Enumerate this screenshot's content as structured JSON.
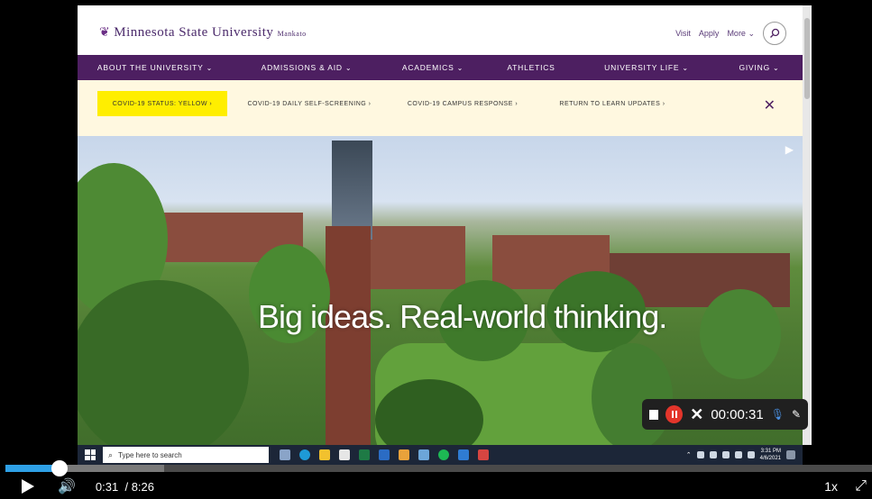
{
  "site": {
    "logo_text": "Minnesota State University",
    "logo_sub": "Mankato",
    "header_links": [
      "Visit",
      "Apply",
      "More"
    ],
    "nav": [
      {
        "label": "ABOUT THE UNIVERSITY",
        "chevron": true
      },
      {
        "label": "ADMISSIONS & AID",
        "chevron": true
      },
      {
        "label": "ACADEMICS",
        "chevron": true
      },
      {
        "label": "ATHLETICS",
        "chevron": false
      },
      {
        "label": "UNIVERSITY LIFE",
        "chevron": true
      },
      {
        "label": "GIVING",
        "chevron": true
      }
    ],
    "alerts": [
      "COVID-19 STATUS: YELLOW  ›",
      "COVID-19 DAILY SELF-SCREENING  ›",
      "COVID-19 CAMPUS RESPONSE  ›",
      "RETURN TO LEARN UPDATES  ›"
    ],
    "hero_text": "Big ideas. Real-world thinking."
  },
  "taskbar": {
    "search_placeholder": "Type here to search",
    "time": "3:31 PM",
    "date": "4/6/2021"
  },
  "recorder": {
    "time": "00:00:31"
  },
  "player": {
    "current_time": "0:31",
    "duration": "/ 8:26",
    "rate": "1x",
    "progress_fraction": 0.062
  },
  "colors": {
    "nav_purple": "#4d1f61",
    "alert_yellow": "#ffee00",
    "progress_blue": "#2ea0e6"
  }
}
